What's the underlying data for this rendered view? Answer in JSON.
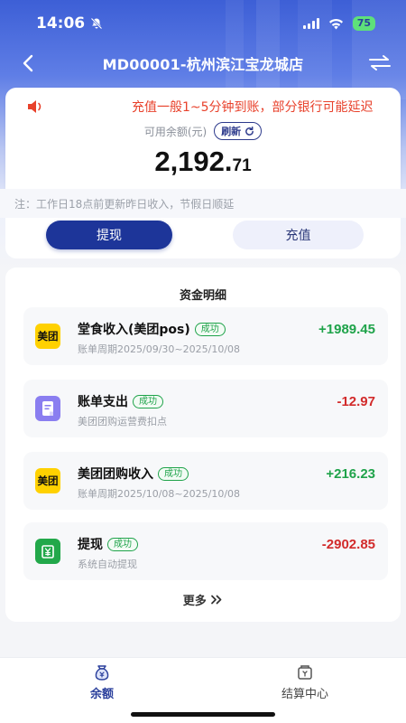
{
  "status_bar": {
    "time": "14:06",
    "battery": "75"
  },
  "nav": {
    "title": "MD00001-杭州滨江宝龙城店"
  },
  "balance": {
    "notice": "充值一般1~5分钟到账，部分银行可能延迟",
    "label": "可用余额(元)",
    "refresh_label": "刷新",
    "amount_int": "2,192.",
    "amount_dec": "71"
  },
  "tip": "注：工作日18点前更新昨日收入，节假日顺延",
  "actions": {
    "withdraw_label": "提现",
    "recharge_label": "充值"
  },
  "details": {
    "title": "资金明细",
    "items": [
      {
        "icon": "meituan-logo-icon",
        "icon_text": "美团",
        "title": "堂食收入(美团pos)",
        "status": "成功",
        "sub": "账单周期2025/09/30~2025/10/08",
        "amount": "+1989.45"
      },
      {
        "icon": "bill-icon",
        "title": "账单支出",
        "status": "成功",
        "sub": "美团团购运营费扣点",
        "amount": "-12.97"
      },
      {
        "icon": "meituan-logo-icon",
        "icon_text": "美团",
        "title": "美团团购收入",
        "status": "成功",
        "sub": "账单周期2025/10/08~2025/10/08",
        "amount": "+216.23"
      },
      {
        "icon": "withdraw-icon",
        "title": "提现",
        "status": "成功",
        "sub": "系统自动提现",
        "amount": "-2902.85"
      }
    ],
    "more_label": "更多"
  },
  "tabs": [
    {
      "label": "余额",
      "active": true
    },
    {
      "label": "结算中心",
      "active": false
    }
  ],
  "colors": {
    "primary": "#1d3599",
    "positive": "#1fa34a",
    "negative": "#d22b2b",
    "notice": "#e8412b"
  }
}
